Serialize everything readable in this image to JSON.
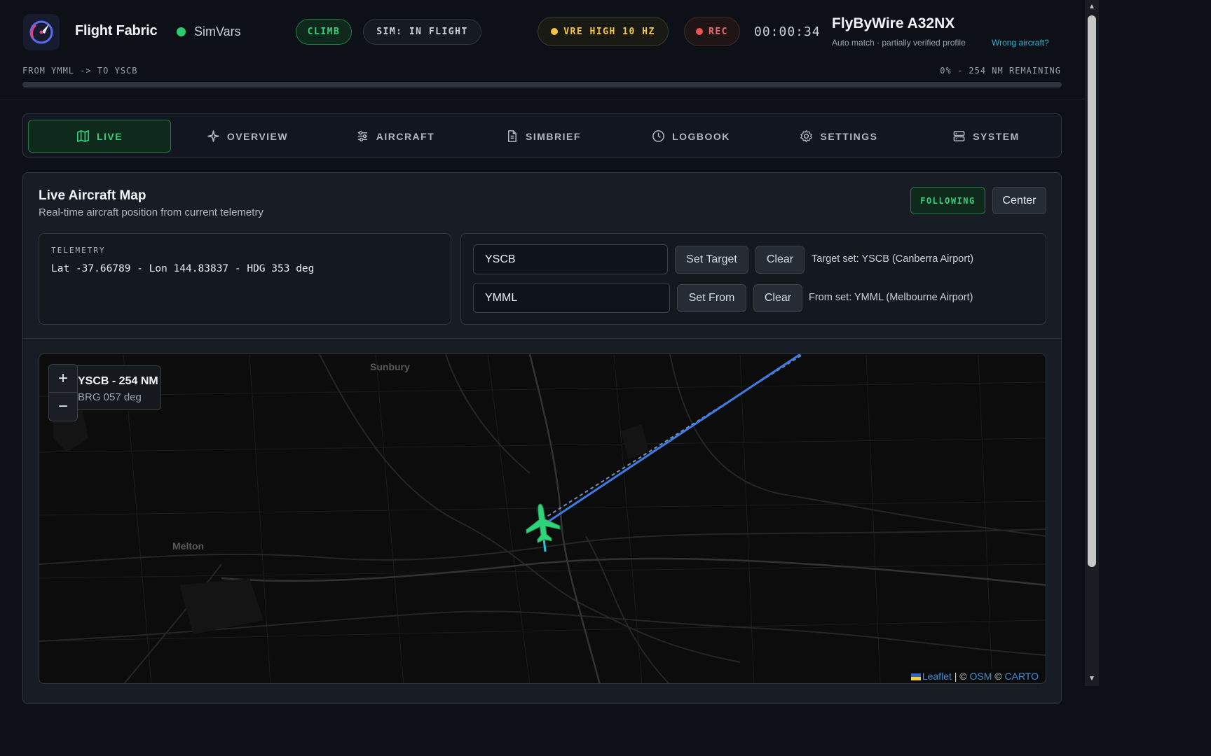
{
  "header": {
    "app_title": "Flight Fabric",
    "source_label": "SimVars",
    "phase": "CLIMB",
    "sim_status": "SIM: IN FLIGHT",
    "vre_label": "VRE HIGH 10 HZ",
    "rec_label": "REC",
    "timer": "00:00:34",
    "aircraft_name": "FlyByWire A32NX",
    "aircraft_match": "Auto match · partially verified profile",
    "wrong_aircraft_link": "Wrong aircraft?",
    "route_text": "FROM YMML -> TO YSCB",
    "remaining_text": "0% - 254 NM REMAINING",
    "progress_fraction": 0.0,
    "colors": {
      "accent_green": "#2fd37a",
      "vre_yellow": "#f5c542",
      "rec_red": "#f06a6a",
      "link_cyan": "#22b8d9"
    }
  },
  "tabs": [
    {
      "label": "LIVE",
      "icon": "map-icon",
      "active": true
    },
    {
      "label": "OVERVIEW",
      "icon": "sparkle-plane-icon",
      "active": false
    },
    {
      "label": "AIRCRAFT",
      "icon": "sliders-icon",
      "active": false
    },
    {
      "label": "SIMBRIEF",
      "icon": "document-icon",
      "active": false
    },
    {
      "label": "LOGBOOK",
      "icon": "clock-icon",
      "active": false
    },
    {
      "label": "SETTINGS",
      "icon": "gear-icon",
      "active": false
    },
    {
      "label": "SYSTEM",
      "icon": "server-icon",
      "active": false
    }
  ],
  "live_panel": {
    "title": "Live Aircraft Map",
    "subtitle": "Real-time aircraft position from current telemetry",
    "following_label": "FOLLOWING",
    "center_label": "Center",
    "telemetry": {
      "label": "TELEMETRY",
      "value": "Lat -37.66789 - Lon 144.83837 - HDG 353 deg"
    },
    "target": {
      "input_value": "YSCB",
      "set_label": "Set Target",
      "clear_label": "Clear",
      "status": "Target set: YSCB (Canberra Airport)"
    },
    "from": {
      "input_value": "YMML",
      "set_label": "Set From",
      "clear_label": "Clear",
      "status": "From set: YMML (Melbourne Airport)"
    }
  },
  "map": {
    "bearing_line1": "YSCB - 254 NM",
    "bearing_line2": "BRG 057 deg",
    "zoom_in": "+",
    "zoom_out": "−",
    "place_labels": [
      "Sunbury",
      "Melton"
    ],
    "attribution": {
      "leaflet": "Leaflet",
      "sep1": " | © ",
      "osm": "OSM",
      "sep2": " © ",
      "carto": "CARTO"
    },
    "colors": {
      "route_line": "#3f7be0",
      "aircraft": "#2fd37a"
    }
  }
}
